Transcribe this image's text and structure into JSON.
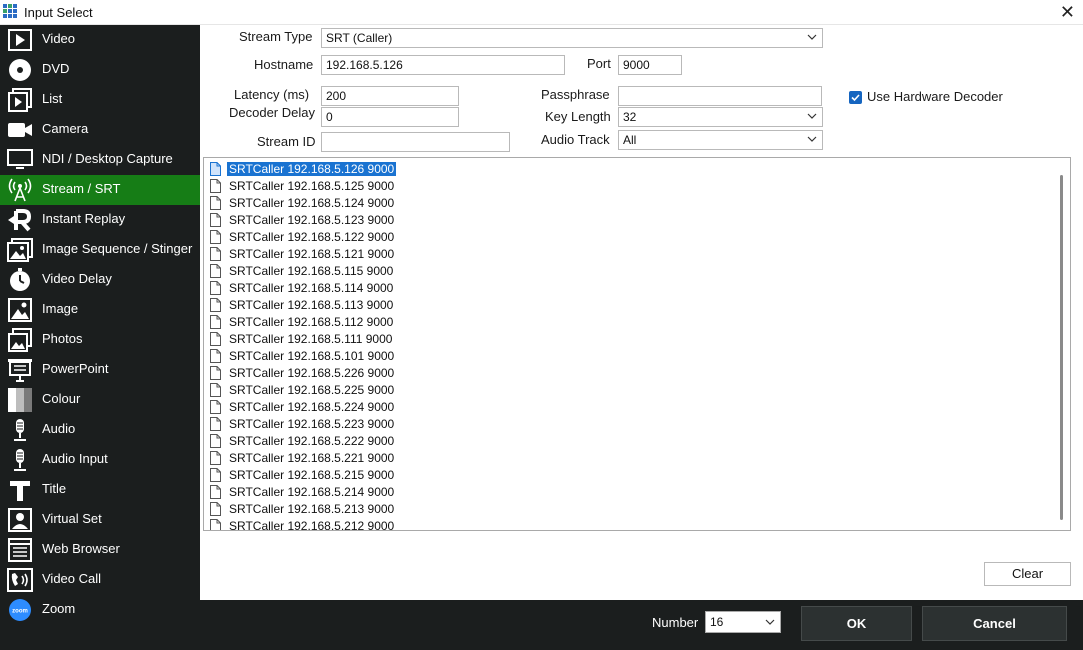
{
  "window": {
    "title": "Input Select"
  },
  "sidebar": {
    "items": [
      {
        "label": "Video",
        "icon": "video-icon"
      },
      {
        "label": "DVD",
        "icon": "dvd-icon"
      },
      {
        "label": "List",
        "icon": "list-icon"
      },
      {
        "label": "Camera",
        "icon": "camera-icon"
      },
      {
        "label": "NDI / Desktop Capture",
        "icon": "monitor-icon"
      },
      {
        "label": "Stream / SRT",
        "icon": "antenna-icon",
        "active": true
      },
      {
        "label": "Instant Replay",
        "icon": "replay-icon"
      },
      {
        "label": "Image Sequence / Stinger",
        "icon": "image-sequence-icon"
      },
      {
        "label": "Video Delay",
        "icon": "clock-icon"
      },
      {
        "label": "Image",
        "icon": "image-icon"
      },
      {
        "label": "Photos",
        "icon": "photos-icon"
      },
      {
        "label": "PowerPoint",
        "icon": "presentation-icon"
      },
      {
        "label": "Colour",
        "icon": "colour-icon"
      },
      {
        "label": "Audio",
        "icon": "microphone-icon"
      },
      {
        "label": "Audio Input",
        "icon": "microphone-icon"
      },
      {
        "label": "Title",
        "icon": "title-icon"
      },
      {
        "label": "Virtual Set",
        "icon": "virtual-set-icon"
      },
      {
        "label": "Web Browser",
        "icon": "web-browser-icon"
      },
      {
        "label": "Video Call",
        "icon": "video-call-icon"
      },
      {
        "label": "Zoom",
        "icon": "zoom-icon"
      }
    ]
  },
  "form": {
    "stream_type": {
      "label": "Stream Type",
      "value": "SRT (Caller)"
    },
    "hostname": {
      "label": "Hostname",
      "value": "192.168.5.126"
    },
    "port": {
      "label": "Port",
      "value": "9000"
    },
    "latency": {
      "label": "Latency (ms)",
      "value": "200"
    },
    "decoder_delay": {
      "label": "Decoder Delay",
      "value": "0"
    },
    "stream_id": {
      "label": "Stream ID",
      "value": ""
    },
    "passphrase": {
      "label": "Passphrase",
      "value": ""
    },
    "key_length": {
      "label": "Key Length",
      "value": "32"
    },
    "audio_track": {
      "label": "Audio Track",
      "value": "All"
    },
    "hardware_decoder": {
      "label": "Use Hardware Decoder",
      "checked": true
    }
  },
  "streams": [
    "SRTCaller 192.168.5.126 9000",
    "SRTCaller 192.168.5.125 9000",
    "SRTCaller 192.168.5.124 9000",
    "SRTCaller 192.168.5.123 9000",
    "SRTCaller 192.168.5.122 9000",
    "SRTCaller 192.168.5.121 9000",
    "SRTCaller 192.168.5.115 9000",
    "SRTCaller 192.168.5.114 9000",
    "SRTCaller 192.168.5.113 9000",
    "SRTCaller 192.168.5.112 9000",
    "SRTCaller 192.168.5.111 9000",
    "SRTCaller 192.168.5.101 9000",
    "SRTCaller 192.168.5.226 9000",
    "SRTCaller 192.168.5.225 9000",
    "SRTCaller 192.168.5.224 9000",
    "SRTCaller 192.168.5.223 9000",
    "SRTCaller 192.168.5.222 9000",
    "SRTCaller 192.168.5.221 9000",
    "SRTCaller 192.168.5.215 9000",
    "SRTCaller 192.168.5.214 9000",
    "SRTCaller 192.168.5.213 9000",
    "SRTCaller 192.168.5.212 9000"
  ],
  "selected_stream_index": 0,
  "buttons": {
    "clear": "Clear",
    "ok": "OK",
    "cancel": "Cancel"
  },
  "footer": {
    "number_label": "Number",
    "number_value": "16"
  },
  "colors": {
    "sidebar_bg": "#1b1e1e",
    "active_item": "#167d16",
    "selection": "#1a73d1",
    "checkbox": "#1565c0"
  }
}
